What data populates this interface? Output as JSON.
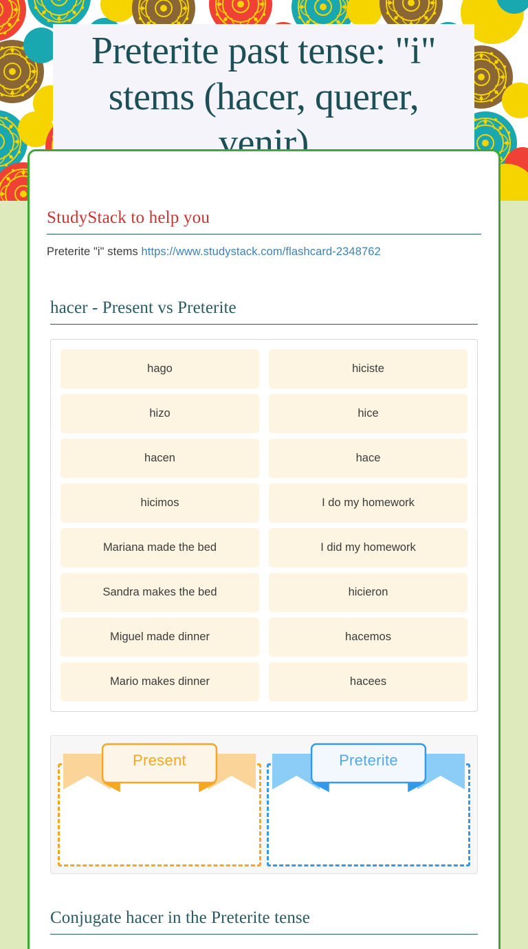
{
  "page": {
    "title": "Preterite past tense: \"i\" stems (hacer, querer, venir)",
    "accent_green": "#3aa935",
    "background_green": "#dfeabc",
    "teal": "#2a5b63",
    "red": "#cc3333",
    "link_blue": "#3c82b8",
    "tile_cream": "#fdf5e2",
    "orange": "#f5a623",
    "blue": "#3399e8"
  },
  "studystack": {
    "heading": "StudyStack to help you",
    "description_prefix": "Preterite \"i\" stems ",
    "link_text": "https://www.studystack.com/flashcard-2348762"
  },
  "match_section": {
    "heading": "hacer - Present vs Preterite",
    "tiles": [
      {
        "label": "hago",
        "column": "left"
      },
      {
        "label": "hiciste",
        "column": "right"
      },
      {
        "label": "hizo",
        "column": "left"
      },
      {
        "label": "hice",
        "column": "right"
      },
      {
        "label": "hacen",
        "column": "left"
      },
      {
        "label": "hace",
        "column": "right"
      },
      {
        "label": "hicimos",
        "column": "left"
      },
      {
        "label": "I do my homework",
        "column": "right"
      },
      {
        "label": "Mariana made the bed",
        "column": "left"
      },
      {
        "label": "I did my homework",
        "column": "right"
      },
      {
        "label": "Sandra makes the bed",
        "column": "left"
      },
      {
        "label": "hicieron",
        "column": "right"
      },
      {
        "label": "Miguel made dinner",
        "column": "left"
      },
      {
        "label": "hacemos",
        "column": "right"
      },
      {
        "label": "Mario makes dinner",
        "column": "left"
      },
      {
        "label": "hacees",
        "column": "right"
      }
    ]
  },
  "sort_section": {
    "categories": [
      {
        "label": "Present",
        "color": "#f5a623",
        "ribbon_fill": "#fbd49a",
        "ribbon_fold": "#f5a623",
        "box_fill": "#fdf6e8"
      },
      {
        "label": "Preterite",
        "color": "#52a8ef",
        "ribbon_fill": "#8ccdf7",
        "ribbon_fold": "#3399e8",
        "box_fill": "#f2f8fd"
      }
    ]
  },
  "bottom_section": {
    "heading": "Conjugate hacer in the Preterite tense"
  }
}
